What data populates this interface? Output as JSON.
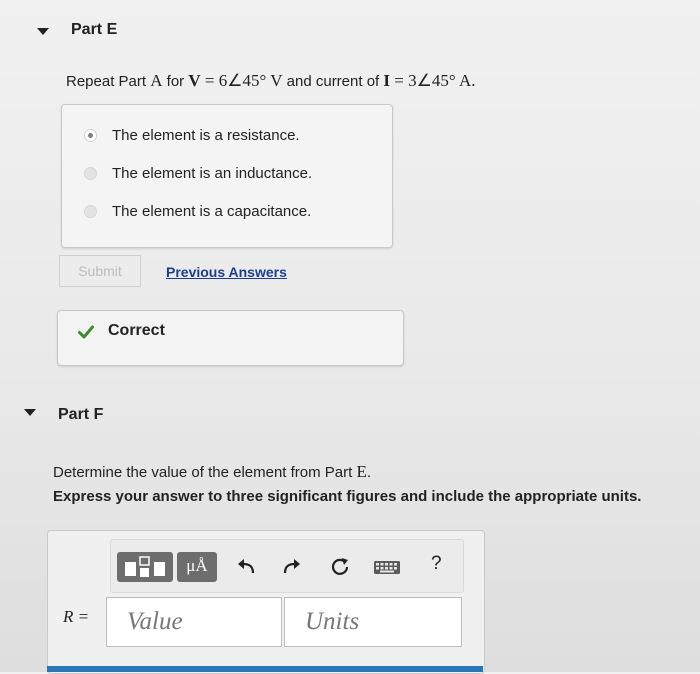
{
  "partE": {
    "title": "Part E",
    "question": {
      "prefix": "Repeat Part ",
      "part_ref": "A",
      "for_text": " for ",
      "v_sym": "V",
      "v_eq": " = 6∠45° V",
      "current_text": " and current of ",
      "i_sym": "I",
      "i_eq": " = 3∠45° A."
    },
    "options": [
      {
        "label": "The element is a resistance.",
        "selected": true
      },
      {
        "label": "The element is an inductance.",
        "selected": false
      },
      {
        "label": "The element is a capacitance.",
        "selected": false
      }
    ],
    "submit_label": "Submit",
    "previous_answers_label": "Previous Answers",
    "feedback": "Correct",
    "feedback_color": "#3f8a2c"
  },
  "partF": {
    "title": "Part F",
    "question": {
      "prefix": "Determine the value of the element from Part ",
      "part_ref": "E",
      "suffix": "."
    },
    "instruction": "Express your answer to three significant figures and include the appropriate units.",
    "toolbar": {
      "templates_icon": "fraction-template-icon",
      "units_label": "μÅ",
      "undo_icon": "undo-icon",
      "redo_icon": "redo-icon",
      "reset_icon": "reset-icon",
      "keyboard_icon": "keyboard-icon",
      "help_label": "?"
    },
    "answer_label": "R =",
    "value_placeholder": "Value",
    "units_placeholder": "Units"
  },
  "colors": {
    "link": "#1b3f8f",
    "accent_strip": "#2a77b8"
  }
}
